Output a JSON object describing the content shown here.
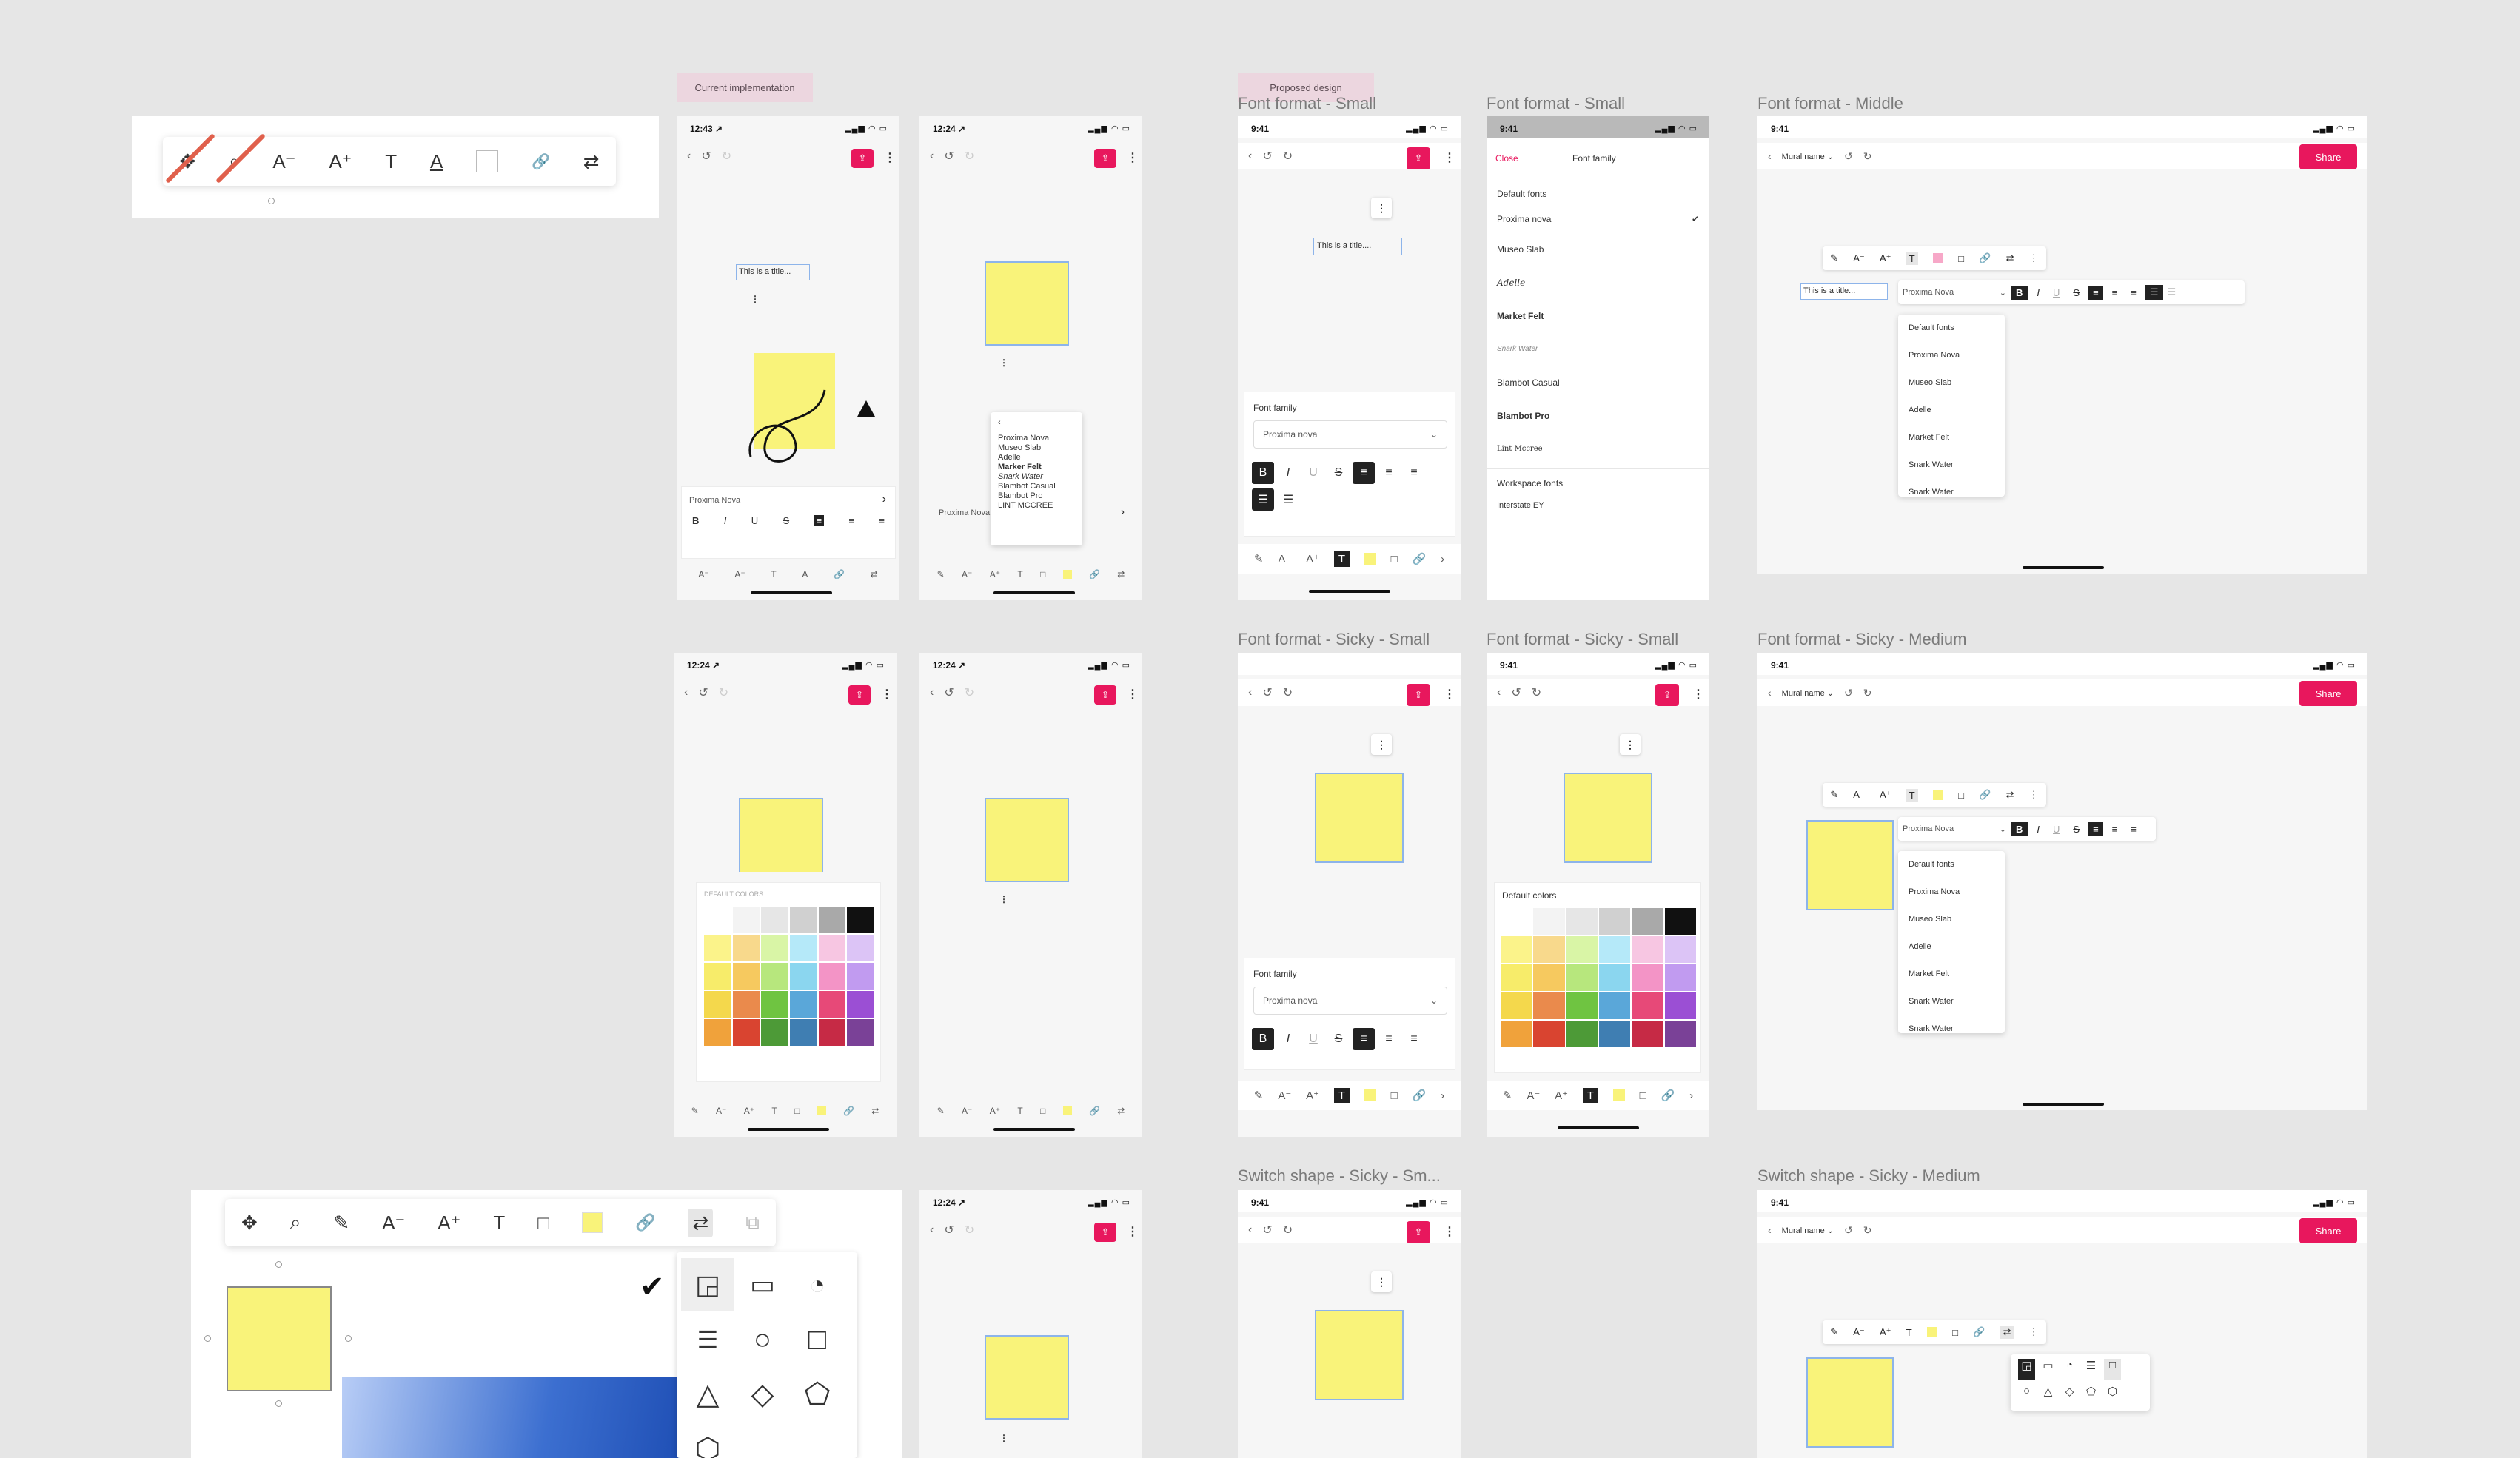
{
  "labels": {
    "current": "Current implementation",
    "proposed": "Proposed design"
  },
  "frame_titles": {
    "ff_small_1": "Font format - Small",
    "ff_small_2": "Font format - Small",
    "ff_middle": "Font format - Middle",
    "ffs_small_1": "Font format - Sicky - Small",
    "ffs_small_2": "Font format - Sicky - Small",
    "ffs_medium": "Font format - Sicky - Medium",
    "sw_small": "Switch shape - Sicky - Sm...",
    "sw_medium": "Switch shape - Sicky - Medium"
  },
  "status": {
    "t1243": "12:43 ↗",
    "t1224": "12:24 ↗",
    "t941": "9:41",
    "signal": "▂▄▆ ◠ ▭"
  },
  "placeholders": {
    "title": "This is a title...",
    "title2": "This is a title...."
  },
  "font_family": {
    "label": "Font family",
    "current": "Proxima nova",
    "current_caps": "Proxima Nova",
    "close": "Close",
    "header": "Font family",
    "default_fonts": "Default fonts",
    "workspace_fonts": "Workspace fonts",
    "workspace_item": "Interstate EY",
    "fonts": [
      "Proxima nova",
      "Museo Slab",
      "Adelle",
      "Market Felt",
      "Snark Water",
      "Blambot Casual",
      "Blambot Pro",
      "Lint Mccree"
    ],
    "fonts_caps": [
      "Proxima Nova",
      "Museo Slab",
      "Adelle",
      "Market Felt",
      "Snark Water",
      "Snark Water"
    ],
    "small_list": [
      "Proxima Nova",
      "Museo Slab",
      "Adelle",
      "Marker Felt",
      "Snark Water",
      "Blambot Casual",
      "Blambot Pro",
      "LINT MCCREE"
    ]
  },
  "colors": {
    "label": "Default colors",
    "label_caps": "DEFAULT COLORS",
    "grid": [
      "#ffffff",
      "#f3f3f3",
      "#e6e6e6",
      "#d0d0d0",
      "#a9a9a9",
      "#111111",
      "#fbf38a",
      "#f8d98c",
      "#d9f5a6",
      "#b5e9f9",
      "#f7c6e2",
      "#dcc4f6",
      "#f7ec6a",
      "#f6c95f",
      "#b7e77d",
      "#8bd6ef",
      "#f394c6",
      "#c19bf0",
      "#f4d84c",
      "#ea8a4c",
      "#6fc441",
      "#5aa7d9",
      "#e74978",
      "#9b4fd4",
      "#f0a23b",
      "#d94430",
      "#4d9a37",
      "#3f7eb2",
      "#c62a45",
      "#7a4197"
    ]
  },
  "mural": {
    "name": "Mural name ⌄",
    "share": "Share"
  },
  "icons": {
    "move": "✥",
    "focus": "⌕",
    "shrink": "A⁻",
    "grow": "A⁺",
    "text": "T",
    "underline": "A",
    "link": "🔗",
    "swap": "⇄",
    "pencil": "✎",
    "square": "□",
    "chevron": "›",
    "back": "‹",
    "undo": "↺",
    "redo": "↻",
    "more": "⋮",
    "check": "✔",
    "upload": "⇪",
    "down": "⌄"
  },
  "accent": "#e8175d"
}
